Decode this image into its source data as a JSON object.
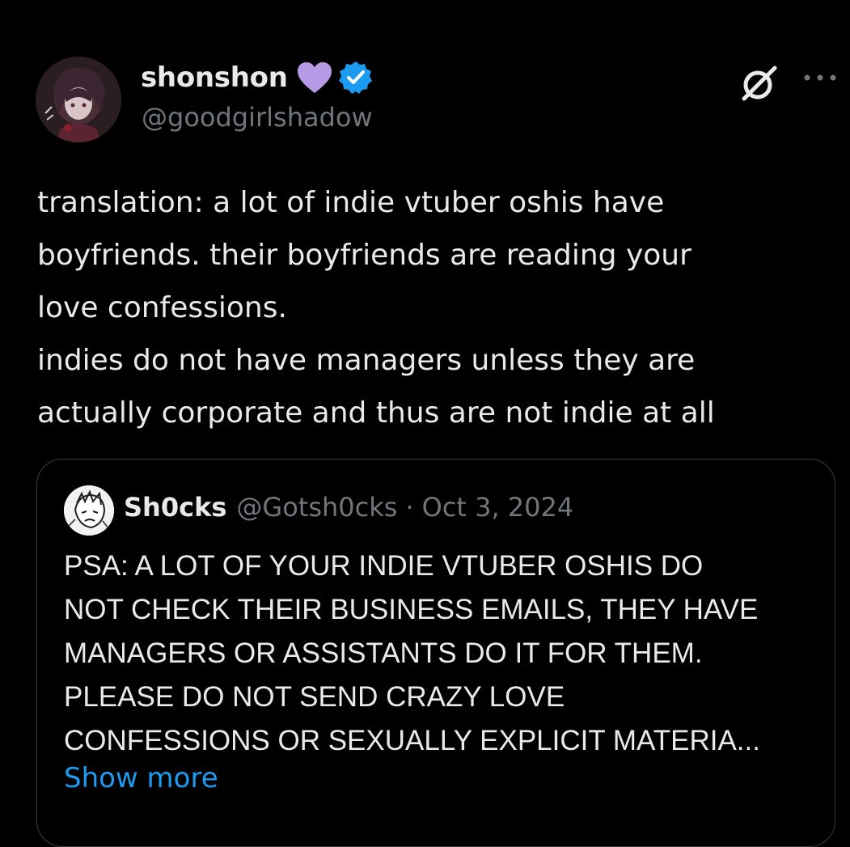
{
  "tweet": {
    "display_name": "shonshon",
    "handle": "@goodgirlshadow",
    "body_lines": [
      "translation: a lot of indie vtuber oshis have",
      "boyfriends. their boyfriends are reading your",
      "love confessions.",
      "indies do not have managers unless they are",
      "actually corporate and thus are not indie at all"
    ],
    "icons": {
      "name_badge": "purple-heart-icon",
      "verified": "verified-badge-icon",
      "grok": "grok-icon",
      "more": "more-options-icon"
    }
  },
  "quote": {
    "display_name": "Sh0cks",
    "handle": "@Gotsh0cks",
    "separator": "·",
    "date": "Oct 3, 2024",
    "body_lines": [
      "PSA: A LOT OF YOUR INDIE VTUBER OSHIS DO",
      "NOT CHECK THEIR BUSINESS EMAILS, THEY HAVE",
      "MANAGERS OR ASSISTANTS DO IT FOR THEM.",
      "PLEASE DO NOT SEND CRAZY LOVE",
      "CONFESSIONS OR SEXUALLY EXPLICIT MATERIA..."
    ],
    "show_more_label": "Show more"
  },
  "colors": {
    "background": "#000000",
    "primary_text": "#e7e9ea",
    "secondary_text": "#71767b",
    "link": "#1d9bf0",
    "verified": "#1d9bf0",
    "heart": "#b79ae6",
    "card_border": "#3a3d40"
  }
}
